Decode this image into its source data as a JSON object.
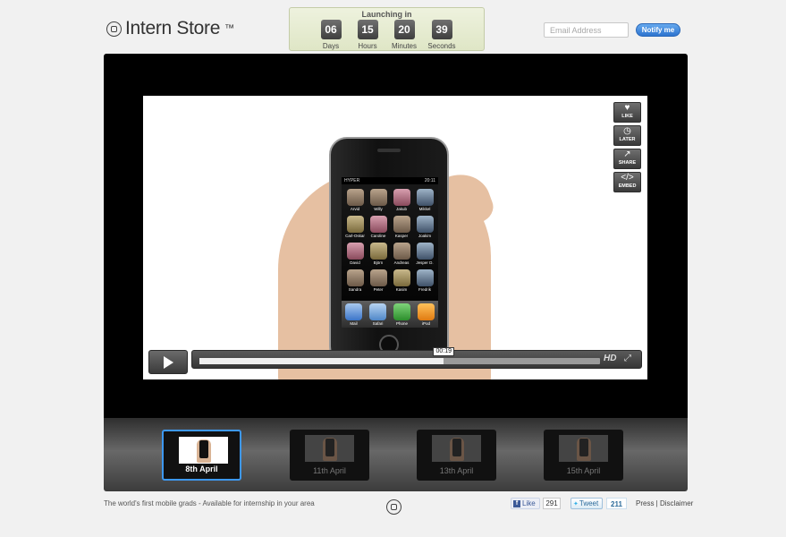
{
  "header": {
    "logo_text": "Intern Store",
    "logo_mark": "™",
    "countdown": {
      "title": "Launching in",
      "units": [
        {
          "value": "06",
          "label": "Days"
        },
        {
          "value": "15",
          "label": "Hours"
        },
        {
          "value": "20",
          "label": "Minutes"
        },
        {
          "value": "39",
          "label": "Seconds"
        }
      ]
    },
    "email_placeholder": "Email Address",
    "notify_label": "Notify me"
  },
  "video": {
    "side_actions": [
      {
        "icon": "heart-icon",
        "label": "LIKE"
      },
      {
        "icon": "clock-icon",
        "label": "LATER"
      },
      {
        "icon": "share-icon",
        "label": "SHARE"
      },
      {
        "icon": "code-icon",
        "label": "EMBED"
      }
    ],
    "phone": {
      "carrier": "HYPER",
      "time": "20:11",
      "apps": [
        "Arvid",
        "Willy",
        "Jakub",
        "Mikkel",
        "Carl-Oskar",
        "Caroline",
        "Kasper",
        "Joakim",
        "David",
        "Björn",
        "Andreas",
        "Jesper D.",
        "Sandra",
        "Peter",
        "Kasim",
        "Fredrik"
      ],
      "dock": [
        "Mail",
        "Safari",
        "Phone",
        "iPod"
      ]
    },
    "time_tooltip": "00:19",
    "progress": 0.61,
    "hd_label": "HD"
  },
  "playlist": [
    {
      "label": "8th April",
      "active": true
    },
    {
      "label": "11th April",
      "active": false
    },
    {
      "label": "13th April",
      "active": false
    },
    {
      "label": "15th April",
      "active": false
    }
  ],
  "footer": {
    "tagline": "The world's first mobile grads - Available for internship in your area",
    "like_label": "Like",
    "like_count": "291",
    "tweet_label": "Tweet",
    "tweet_count": "211",
    "press_label": "Press",
    "separator": " | ",
    "disclaimer_label": "Disclaimer"
  },
  "colors": {
    "accent_blue": "#2d74cf",
    "thumb_active_border": "#3d98f0",
    "countdown_bg": "#e6ecd2"
  }
}
